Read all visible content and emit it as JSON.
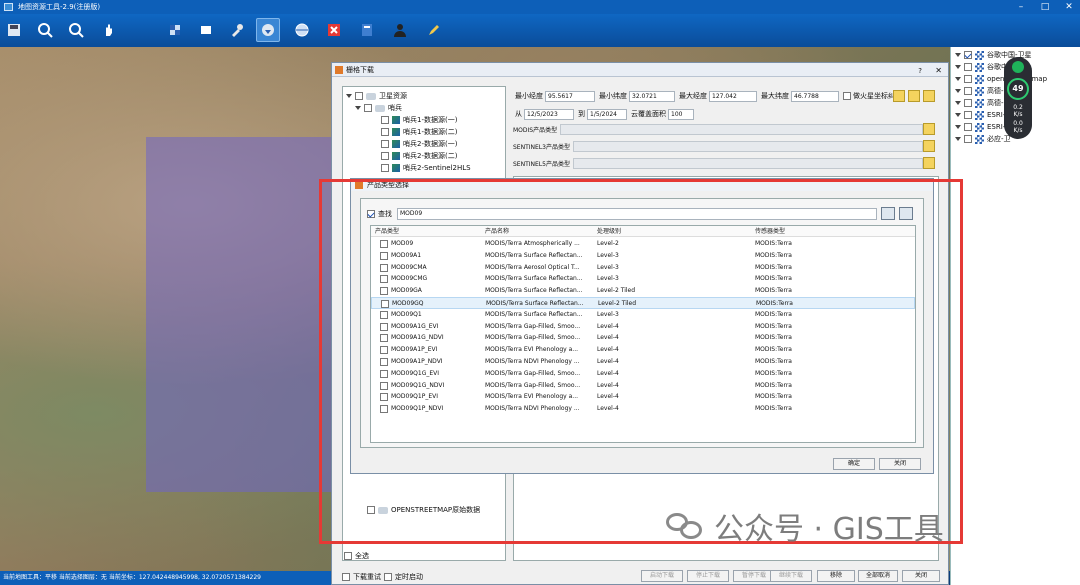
{
  "app": {
    "title": "地图资源工具-2.9(注册版)"
  },
  "toolbar": {
    "icons": [
      "save-icon",
      "zoom-in-icon",
      "zoom-out-icon",
      "pan-hand-icon",
      "layers-icon",
      "select-icon",
      "tools-icon",
      "download-globe-icon",
      "globe-icon",
      "close-red-icon",
      "book-icon",
      "user-icon",
      "pen-icon"
    ]
  },
  "statusbar": {
    "text": "当前地图工具：平移  当前选择图层：无  当前坐标：127.042448945998, 32.0720571384229"
  },
  "layers": {
    "items": [
      {
        "label": "谷歌中国-卫星",
        "checked": true
      },
      {
        "label": "谷歌中",
        "checked": false
      },
      {
        "label": "open",
        "checked": false
      },
      {
        "label": "高德-",
        "checked": false
      },
      {
        "label": "高德-",
        "checked": false
      },
      {
        "label": "ESRI-",
        "checked": false
      },
      {
        "label": "ESRI-",
        "checked": false
      },
      {
        "label": "必应-卫",
        "checked": false
      }
    ],
    "map_suffix": "map"
  },
  "widget": {
    "value": "49",
    "s1": "0.2",
    "s1u": "K/s",
    "s2": "0.0",
    "s2u": "K/s"
  },
  "main_dialog": {
    "title": "栅格下载",
    "help": "?",
    "close": "✕",
    "tree": {
      "root": "卫星资源",
      "group": "哨兵",
      "items": [
        "哨兵1-数据源(一)",
        "哨兵1-数据源(二)",
        "哨兵2-数据源(一)",
        "哨兵2-数据源(二)",
        "哨兵2-Sentinel2HLS"
      ],
      "osm": "OPENSTREETMAP原始数据",
      "select_all": "全选"
    },
    "coords": {
      "min_lon_label": "最小经度",
      "min_lon": "95.5617",
      "min_lat_label": "最小纬度",
      "min_lat": "32.0721",
      "max_lon_label": "最大经度",
      "max_lon": "127.042",
      "max_lat_label": "最大纬度",
      "max_lat": "46.7788",
      "fire_label": "做火星坐标纠偏"
    },
    "date": {
      "from_label": "从",
      "from": "12/5/2023",
      "to_label": "到",
      "to": "1/5/2024",
      "cloud_label": "云覆盖面积",
      "cloud": "100"
    },
    "product_rows": [
      "MODIS产品类型",
      "SENTINEL3产品类型",
      "SENTINEL5产品类型"
    ],
    "bottom": {
      "resume": "下载重试",
      "autostart": "定时启动",
      "start": "启动下载",
      "stop": "停止下载",
      "pause": "暂停下载",
      "continue": "继续下载",
      "remove": "移除",
      "cancel_all": "全部取消",
      "close": "关闭"
    }
  },
  "product_dialog": {
    "title": "产品类型选择",
    "search_label": "查找",
    "search_value": "MOD09",
    "columns": [
      "产品类型",
      "产品名称",
      "处理级别",
      "传感器类型"
    ],
    "rows": [
      [
        "MOD09",
        "MODIS/Terra Atmospherically ...",
        "Level-2",
        "MODIS:Terra"
      ],
      [
        "MOD09A1",
        "MODIS/Terra Surface Reflectan...",
        "Level-3",
        "MODIS:Terra"
      ],
      [
        "MOD09CMA",
        "MODIS/Terra Aerosol Optical T...",
        "Level-3",
        "MODIS:Terra"
      ],
      [
        "MOD09CMG",
        "MODIS/Terra Surface Reflectan...",
        "Level-3",
        "MODIS:Terra"
      ],
      [
        "MOD09GA",
        "MODIS/Terra Surface Reflectan...",
        "Level-2 Tiled",
        "MODIS:Terra"
      ],
      [
        "MOD09GQ",
        "MODIS/Terra Surface Reflectan...",
        "Level-2 Tiled",
        "MODIS:Terra"
      ],
      [
        "MOD09Q1",
        "MODIS/Terra Surface Reflectan...",
        "Level-3",
        "MODIS:Terra"
      ],
      [
        "MOD09A1G_EVI",
        "MODIS/Terra Gap-Filled, Smoo...",
        "Level-4",
        "MODIS:Terra"
      ],
      [
        "MOD09A1G_NDVI",
        "MODIS/Terra Gap-Filled, Smoo...",
        "Level-4",
        "MODIS:Terra"
      ],
      [
        "MOD09A1P_EVI",
        "MODIS/Terra EVI Phenology a...",
        "Level-4",
        "MODIS:Terra"
      ],
      [
        "MOD09A1P_NDVI",
        "MODIS/Terra NDVI Phenology ...",
        "Level-4",
        "MODIS:Terra"
      ],
      [
        "MOD09Q1G_EVI",
        "MODIS/Terra Gap-Filled, Smoo...",
        "Level-4",
        "MODIS:Terra"
      ],
      [
        "MOD09Q1G_NDVI",
        "MODIS/Terra Gap-Filled, Smoo...",
        "Level-4",
        "MODIS:Terra"
      ],
      [
        "MOD09Q1P_EVI",
        "MODIS/Terra EVI Phenology a...",
        "Level-4",
        "MODIS:Terra"
      ],
      [
        "MOD09Q1P_NDVI",
        "MODIS/Terra NDVI Phenology ...",
        "Level-4",
        "MODIS:Terra"
      ]
    ],
    "selected_row": 5,
    "ok": "确定",
    "close": "关闭"
  },
  "watermark": {
    "text": "公众号 · GIS工具"
  },
  "colors": {
    "highlight": "#e53935",
    "titlebar": "#0d5fb8"
  }
}
